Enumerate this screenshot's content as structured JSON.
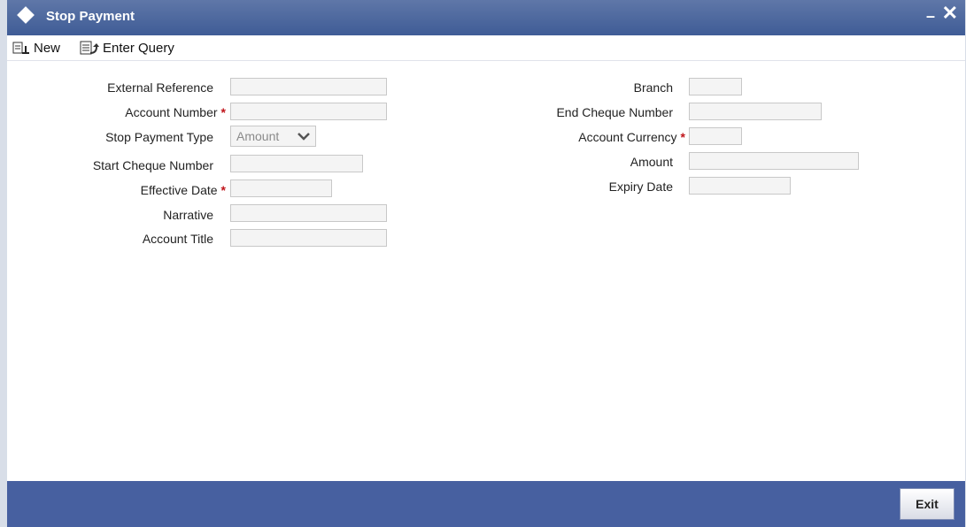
{
  "window": {
    "title": "Stop Payment"
  },
  "toolbar": {
    "new_label": "New",
    "enter_query_label": "Enter Query"
  },
  "form": {
    "external_reference": {
      "label": "External Reference",
      "value": ""
    },
    "account_number": {
      "label": "Account Number",
      "required": "*",
      "value": ""
    },
    "stop_payment_type": {
      "label": "Stop Payment Type",
      "selected": "Amount"
    },
    "start_cheque_number": {
      "label": "Start Cheque Number",
      "value": ""
    },
    "effective_date": {
      "label": "Effective Date",
      "required": "*",
      "value": ""
    },
    "narrative": {
      "label": "Narrative",
      "value": ""
    },
    "account_title": {
      "label": "Account Title",
      "value": ""
    },
    "branch": {
      "label": "Branch",
      "value": ""
    },
    "end_cheque_number": {
      "label": "End Cheque Number",
      "value": ""
    },
    "account_currency": {
      "label": "Account Currency",
      "required": "*",
      "value": ""
    },
    "amount": {
      "label": "Amount",
      "value": ""
    },
    "expiry_date": {
      "label": "Expiry Date",
      "value": ""
    }
  },
  "footer": {
    "exit_label": "Exit"
  },
  "colors": {
    "titlebar": "#4a66a0",
    "footer": "#4760a0",
    "required": "#c0141a"
  }
}
